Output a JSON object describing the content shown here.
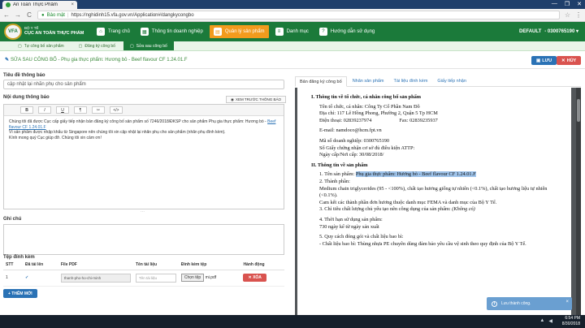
{
  "browser": {
    "tab_title": "An Toàn Thực Phẩm",
    "tab_close": "×",
    "secure_label": "Bảo mật",
    "url_prefix": "https://",
    "url_host": "nghidinh15.vfa.gov.vn",
    "url_path": "/Application#/dangkycongbo",
    "back": "←",
    "forward": "→",
    "reload": "C",
    "star": "☆",
    "menu": "⋮",
    "win_min": "—",
    "win_max": "❐",
    "win_close": "✕"
  },
  "header": {
    "logo_mark": "VFA",
    "logo_line1": "BỘ Y TẾ",
    "logo_line2": "CỤC AN TOÀN THỰC PHẨM",
    "nav": [
      {
        "label": "Trang chủ",
        "icon": "home-icon",
        "glyph": "⌂"
      },
      {
        "label": "Thông tin doanh nghiệp",
        "icon": "building-icon",
        "glyph": "▦"
      },
      {
        "label": "Quản lý sản phẩm",
        "icon": "box-icon",
        "glyph": "▤"
      },
      {
        "label": "Danh mục",
        "icon": "list-icon",
        "glyph": "≡"
      },
      {
        "label": "Hướng dẫn sử dụng",
        "icon": "book-icon",
        "glyph": "?"
      }
    ],
    "user_label": "DEFAULT",
    "user_code": "- 0300765190"
  },
  "subnav": {
    "items": [
      {
        "label": "Tự công bố sản phẩm"
      },
      {
        "label": "Đăng ký công bố"
      },
      {
        "label": "Sửa sau công bố"
      }
    ],
    "active_index": 2
  },
  "page": {
    "title_prefix": "✎",
    "title": "SỬA SAU CÔNG BỐ - Phụ gia thực phẩm: Hương bỏ - Beef flavour CF 1.24.01.F",
    "save_label": "LƯU",
    "cancel_label": "HỦY"
  },
  "form": {
    "title_label": "Tiêu đề thông báo",
    "title_value": "cập nhật lại nhãn phụ cho sản phẩm",
    "content_label": "Nội dung thông báo",
    "preview_button": "XEM TRƯỚC THÔNG BÁO",
    "toolbar": [
      "B",
      "I",
      "U",
      "¶",
      "✂",
      "</>"
    ],
    "body_line1": "Chúng tôi đã được Cục cấp giấy tiếp nhận bản đăng ký công bố sản phẩm số 7246/2018/ĐKSP cho sản phẩm Phụ gia thực phẩm: Hương bò - ",
    "body_link": "Beef flavour CF 1.24.01.F",
    "body_line2": "Vì sản phẩm được nhập khẩu từ Singapore nên chúng tôi xin cập nhật lại nhãn phụ cho sản phẩm (nhãn phụ đính kèm).",
    "body_line3": "Kính mong quý Cục giúp đỡ. Chúng tôi xin cảm ơn!",
    "notes_label": "Ghi chú",
    "attach_label": "Tệp đính kèm",
    "attach_headers": [
      "STT",
      "Đã tải lên",
      "File PDF",
      "Tên tài liệu",
      "Đính kèm tệp",
      "Hành động"
    ],
    "attach_rows": [
      {
        "stt": "1",
        "uploaded": "✓",
        "pdf": "thanh-pho-ho-chi-minh",
        "doc_placeholder": "Tên tài liệu",
        "choose": "Chọn tệp",
        "file": "mi.pdf",
        "action": "XÓA"
      }
    ],
    "add_button": "+ THÊM MỚI"
  },
  "right": {
    "tabs": [
      "Bản đăng ký công bố",
      "Nhãn sản phẩm",
      "Tài liệu đính kèm",
      "Giấy tiếp nhận"
    ],
    "active_tab": 0
  },
  "doc": {
    "s1": "I. Thông tin về tổ chức, cá nhân công bố sản phẩm",
    "org": "Tên tổ chức, cá nhân: Công Ty Cổ Phần Nam Đô",
    "addr": "Địa chỉ: 117 Lê Hồng Phong, Phường 2, Quận 5 Tp HCM",
    "phone": "Điện thoại: 02839237974",
    "fax": "Fax: 02839235937",
    "email": "E-mail: namdoco@hcm.fpt.vn",
    "bizcode": "Mã số doanh nghiệp: 0300765190",
    "cert": "Số Giấy chứng nhận cơ sở đủ điều kiện ATTP:",
    "certdate": "Ngày cấp/Nơi cấp: 30/08/2018/",
    "s2": "II. Thông tin về sản phẩm",
    "p1_prefix": "1. Tên sản phẩm: ",
    "p1_name": "Phụ gia thực phẩm: Hương bò - Beef flavour CF 1.24.01.F",
    "p2": "2. Thành phần:",
    "p2_detail": "Medium chain triglycerides (95 - <100%), chất tạo hương giống tự nhiên (<0.1%), chất tạo hương liệu tự nhiên (<0.1%).",
    "p2_commit": "Cam kết các thành phần đơn hương thuộc danh mục FEMA và danh mục của Bộ Y Tế.",
    "p3_prefix": "3. Chỉ tiêu chất lượng chủ yếu tạo nên công dụng của sản phẩm: ",
    "p3_note": "(Không có)",
    "p4": "4. Thời hạn sử dụng sản phẩm:",
    "p4_detail": "730 ngày kể từ ngày sản xuất",
    "p5": "5. Quy cách đóng gói và chất liệu bao bì:",
    "p5_detail": "- Chất liệu bao bì: Thùng nhựa PE chuyên dùng đảm bảo yêu cầu vệ sinh theo quy định của Bộ Y Tế."
  },
  "toast": {
    "icon": "i",
    "text": "Lưu thành công.",
    "close": "×"
  },
  "taskbar": {
    "time": "6:54 PM",
    "date": "8/30/2018"
  }
}
